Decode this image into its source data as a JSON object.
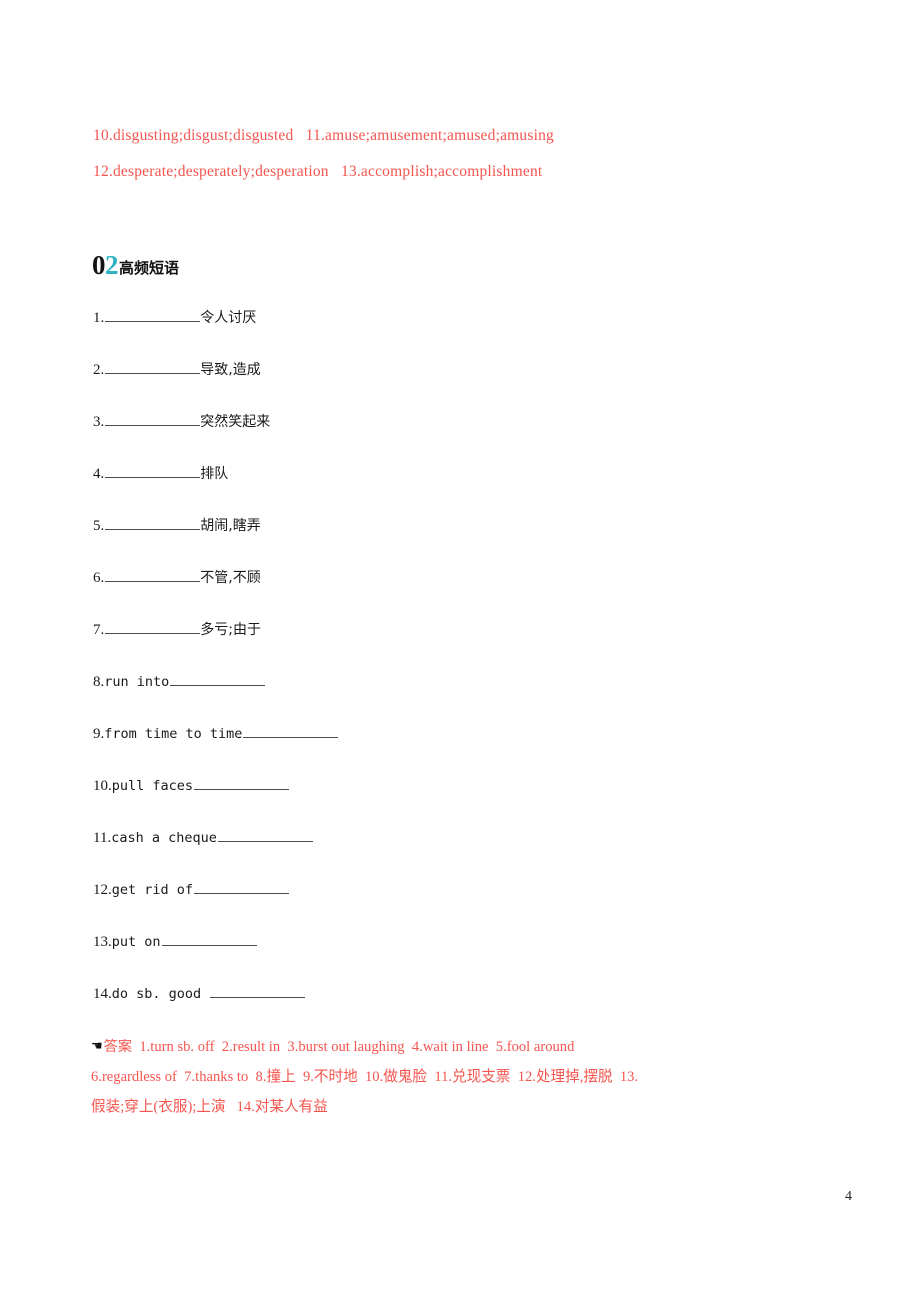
{
  "page": {
    "number": "4",
    "accent_teal": "#2bb3c4",
    "answer_red": "#f4554f",
    "text_black": "#1a1a1a"
  },
  "top_answers": {
    "lines": [
      "10.disgusting;disgust;disgusted   11.amuse;amusement;amused;amusing",
      "12.desperate;desperately;desperation   13.accomplish;accomplishment"
    ]
  },
  "section": {
    "number_first": "0",
    "number_second": "2",
    "title": "高频短语"
  },
  "items": [
    {
      "index": "1.",
      "english": "",
      "blank": true,
      "chinese": "令人讨厌"
    },
    {
      "index": "2.",
      "english": "",
      "blank": true,
      "chinese": "导致,造成"
    },
    {
      "index": "3.",
      "english": "",
      "blank": true,
      "chinese": "突然笑起来"
    },
    {
      "index": "4.",
      "english": "",
      "blank": true,
      "chinese": "排队"
    },
    {
      "index": "5.",
      "english": "",
      "blank": true,
      "chinese": "胡闹,瞎弄"
    },
    {
      "index": "6.",
      "english": "",
      "blank": true,
      "chinese": "不管,不顾"
    },
    {
      "index": "7.",
      "english": "",
      "blank": true,
      "chinese": "多亏;由于"
    },
    {
      "index": "8.",
      "english": "run into",
      "blank": true,
      "chinese": ""
    },
    {
      "index": "9.",
      "english": "from time to time",
      "blank": true,
      "chinese": ""
    },
    {
      "index": "10.",
      "english": "pull faces",
      "blank": true,
      "chinese": ""
    },
    {
      "index": "11.",
      "english": "cash a cheque",
      "blank": true,
      "chinese": ""
    },
    {
      "index": "12.",
      "english": "get rid of",
      "blank": true,
      "chinese": ""
    },
    {
      "index": "13.",
      "english": "put on",
      "blank": true,
      "chinese": ""
    },
    {
      "index": "14.",
      "english": "do sb. good",
      "blank": true,
      "chinese": ""
    }
  ],
  "answers": {
    "bullet": "☚",
    "label": "答案",
    "line1": "  1.turn sb. off  2.result in  3.burst out laughing  4.wait in line  5.fool around",
    "line2": "6.regardless of  7.thanks to  8.撞上  9.不时地  10.做鬼脸  11.兑现支票  12.处理掉,摆脱  13.",
    "line3": "假装;穿上(衣服);上演   14.对某人有益"
  }
}
